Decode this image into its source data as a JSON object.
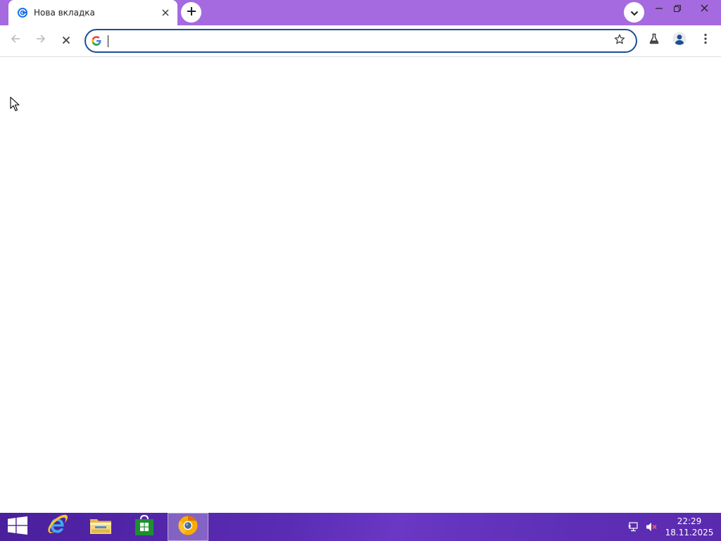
{
  "browser": {
    "tab": {
      "title": "Нова вкладка",
      "favicon": "new-tab-favicon-icon"
    },
    "window_controls": [
      "minimize-icon",
      "restore-icon",
      "close-icon"
    ],
    "toolbar": {
      "back": "arrow-left-icon",
      "forward": "arrow-right-icon",
      "stop": "stop-x-icon"
    },
    "omnibox": {
      "value": "",
      "placeholder": "",
      "engine_icon": "google-g-icon"
    },
    "actions": [
      "star-icon",
      "labs-flask-icon",
      "profile-icon",
      "kebab-menu-icon"
    ],
    "accent_color": "#a66ae0",
    "focus_color": "#1a4f93"
  },
  "taskbar": {
    "apps": [
      "windows-start-icon",
      "internet-explorer-icon",
      "file-explorer-icon",
      "windows-store-icon",
      "chrome-canary-icon"
    ],
    "tray": {
      "network": "network-warning-icon",
      "volume": "volume-muted-icon"
    },
    "clock": {
      "time": "22:29",
      "date": "18.11.2025"
    }
  }
}
